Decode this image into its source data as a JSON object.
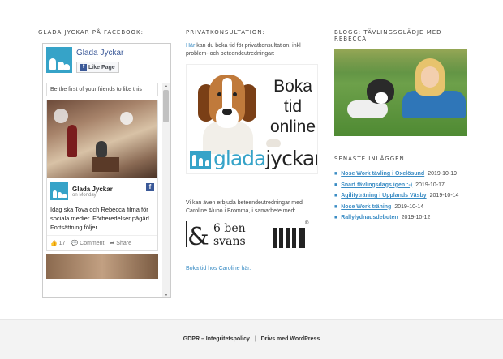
{
  "facebook": {
    "title": "GLADA JYCKAR PÅ FACEBOOK:",
    "page_name": "Glada Jyckar",
    "like_label": "Like Page",
    "first_friends": "Be the first of your friends to like this",
    "post": {
      "author": "Glada Jyckar",
      "date": "on Monday",
      "text": "Idag ska Tova och Rebecca filma för sociala medier. Förberedelser pågår! Fortsättning följer...",
      "likes": "17",
      "comment_label": "Comment",
      "share_label": "Share"
    }
  },
  "private": {
    "title": "PRIVATKONSULTATION:",
    "link_text": "Här",
    "intro_rest": "kan du boka tid för privatkonsultation, inkl problem- och beteendeutredningar:",
    "banner_line1": "Boka",
    "banner_line2": "tid",
    "banner_line3": "online",
    "logo_part1": "glada",
    "logo_part2": "jyckar",
    "partner_text": "Vi kan även erbjuda beteendeutredningar med Caroline Alupo i Bromma, i samarbete med:",
    "partner_logo_amp": "&",
    "partner_logo_line1": "6 ben",
    "partner_logo_line2": "svans",
    "partner_logo_reg": "®",
    "caroline_link": "Boka tid hos Caroline här."
  },
  "blog": {
    "title": "BLOGG: TÄVLINGSGLÄDJE MED REBECCA",
    "recent_title": "SENASTE INLÄGGEN",
    "posts": [
      {
        "title": "Nose Work tävling i Oxelösund",
        "date": "2019-10-19"
      },
      {
        "title": "Snart tävlingsdags igen :-)",
        "date": "2019-10-17"
      },
      {
        "title": "Agilityträning i Upplands Väsby",
        "date": "2019-10-14"
      },
      {
        "title": "Nose Work träning",
        "date": "2019-10-14"
      },
      {
        "title": "Rallylydnadsdebuten",
        "date": "2019-10-12"
      }
    ]
  },
  "footer": {
    "gdpr": "GDPR – Integritetspolicy",
    "separator": "|",
    "wordpress": "Drivs med WordPress"
  }
}
